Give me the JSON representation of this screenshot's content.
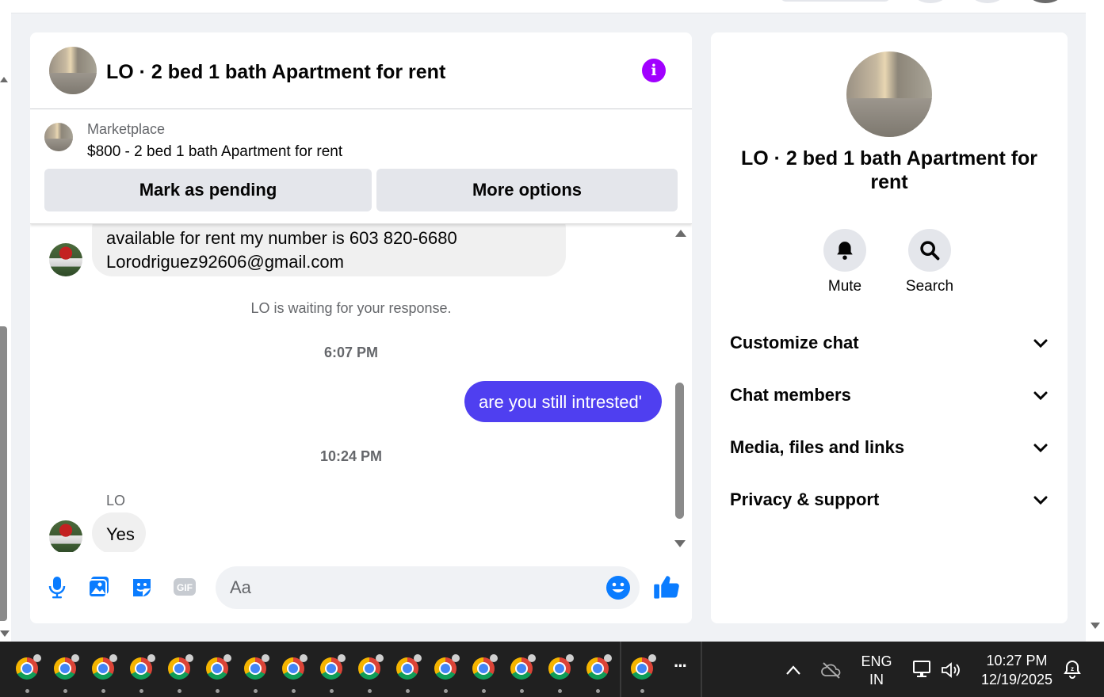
{
  "chat": {
    "title": "LO · 2 bed 1 bath Apartment for rent",
    "listing": {
      "source": "Marketplace",
      "price_title": "$800 - 2 bed 1 bath Apartment for rent",
      "mark_pending_label": "Mark as pending",
      "more_options_label": "More options"
    },
    "messages": {
      "incoming_1_line1": "available for rent my number is 603 820-6680",
      "incoming_1_line2": "Lorodriguez92606@gmail.com",
      "waiting_notice": "LO is waiting for your response.",
      "time_1": "6:07 PM",
      "outgoing_1": "are you still intrested'",
      "time_2": "10:24 PM",
      "sender_name": "LO",
      "incoming_2": "Yes"
    },
    "composer": {
      "placeholder": "Aa"
    }
  },
  "info_panel": {
    "title": "LO · 2 bed 1 bath Apartment for rent",
    "actions": [
      {
        "label": "Mute",
        "icon": "bell-icon"
      },
      {
        "label": "Search",
        "icon": "search-icon"
      }
    ],
    "sections": [
      {
        "label": "Customize chat"
      },
      {
        "label": "Chat members"
      },
      {
        "label": "Media, files and links"
      },
      {
        "label": "Privacy & support"
      }
    ]
  },
  "taskbar": {
    "language": "ENG",
    "region": "IN",
    "time": "10:27 PM",
    "date": "12/19/2025",
    "overflow": "···"
  },
  "colors": {
    "messenger_blue": "#0a7cff",
    "outgoing_bubble": "#4f3ff0",
    "info_purple": "#a100ff"
  }
}
